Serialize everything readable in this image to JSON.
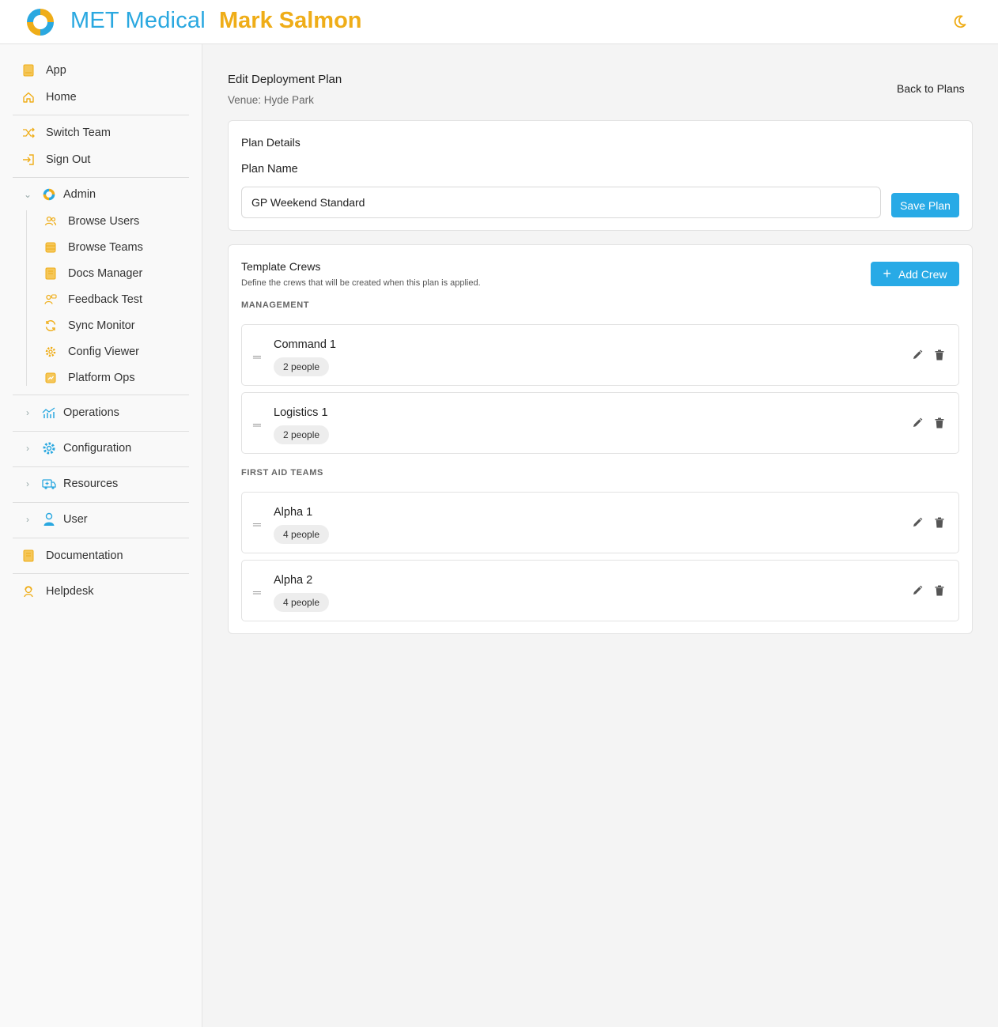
{
  "header": {
    "brand": "MET Medical",
    "user_name": "Mark Salmon",
    "logo_icon": "met-logo",
    "theme_icon": "moon-icon",
    "brand_color": "#2aa8e0",
    "accent_color": "#efad18"
  },
  "sidebar": {
    "app": "App",
    "home": "Home",
    "switch_team": "Switch Team",
    "sign_out": "Sign Out",
    "admin": "Admin",
    "admin_items": [
      "Browse Users",
      "Browse Teams",
      "Docs Manager",
      "Feedback Test",
      "Sync Monitor",
      "Config Viewer",
      "Platform Ops"
    ],
    "operations": "Operations",
    "configuration": "Configuration",
    "resources": "Resources",
    "user": "User",
    "documentation": "Documentation",
    "helpdesk": "Helpdesk"
  },
  "page": {
    "title": "Edit Deployment Plan",
    "venue": "Venue: Hyde Park",
    "back_label": "Back to Plans"
  },
  "plan_details": {
    "title": "Plan Details",
    "name_label": "Plan Name",
    "name_value": "GP Weekend Standard",
    "save_label": "Save Plan"
  },
  "template_crews": {
    "title": "Template Crews",
    "description": "Define the crews that will be created when this plan is applied.",
    "add_label": "Add Crew",
    "sections": [
      {
        "heading": "MANAGEMENT",
        "crews": [
          {
            "name": "Command 1",
            "people": "2 people"
          },
          {
            "name": "Logistics 1",
            "people": "2 people"
          }
        ]
      },
      {
        "heading": "FIRST AID TEAMS",
        "crews": [
          {
            "name": "Alpha 1",
            "people": "4 people"
          },
          {
            "name": "Alpha 2",
            "people": "4 people"
          }
        ]
      }
    ]
  }
}
